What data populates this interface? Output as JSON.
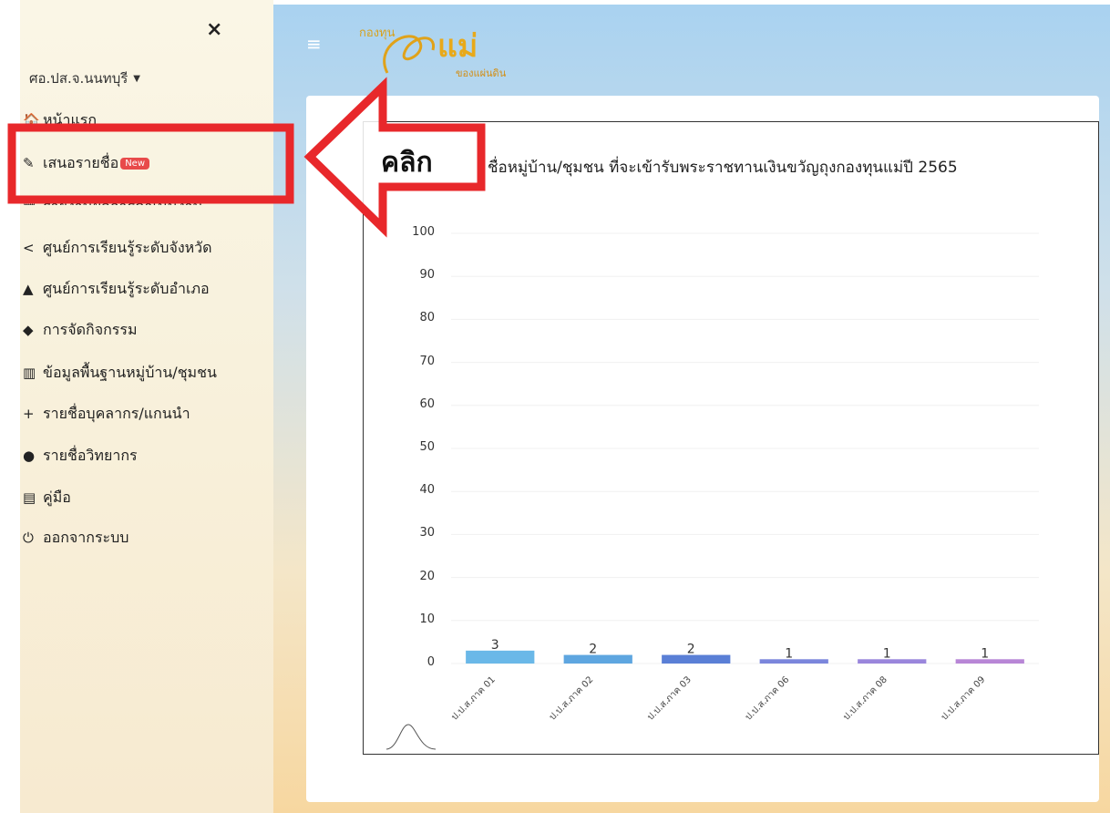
{
  "sidebar": {
    "close_label": "×",
    "org_dropdown": "ศอ.ปส.จ.นนทบุรี",
    "items": [
      {
        "icon": "home-icon",
        "glyph": "🏠",
        "label": "หน้าแรก"
      },
      {
        "icon": "edit-document-icon",
        "glyph": "✎",
        "label": "เสนอรายชื่อ",
        "badge": "New"
      },
      {
        "icon": "report-icon",
        "glyph": "▦",
        "label": "รายงานผลการดำเนินงาน"
      },
      {
        "icon": "share-icon",
        "glyph": "<",
        "label": "ศูนย์การเรียนรู้ระดับจังหวัด"
      },
      {
        "icon": "shapes-icon",
        "glyph": "▲",
        "label": "ศูนย์การเรียนรู้ระดับอำเภอ"
      },
      {
        "icon": "activity-icon",
        "glyph": "◆",
        "label": "การจัดกิจกรรม"
      },
      {
        "icon": "building-icon",
        "glyph": "▥",
        "label": "ข้อมูลพื้นฐานหมู่บ้าน/ชุมชน"
      },
      {
        "icon": "user-plus-icon",
        "glyph": "+",
        "label": "รายชื่อบุคลากร/แกนนำ"
      },
      {
        "icon": "microphone-icon",
        "glyph": "●",
        "label": "รายชื่อวิทยากร"
      },
      {
        "icon": "book-reader-icon",
        "glyph": "▤",
        "label": "คู่มือ"
      },
      {
        "icon": "power-icon",
        "glyph": "⏻",
        "label": "ออกจากระบบ"
      }
    ]
  },
  "header": {
    "menu_glyph": "≡",
    "logo_text_top": "กองทุน",
    "logo_text_main": "แม่",
    "logo_text_bottom": "ของแผ่นดิน"
  },
  "annotation": {
    "click_label": "คลิก",
    "colors": {
      "highlight": "#e8282b"
    }
  },
  "chart_data": {
    "type": "bar",
    "title": "ชื่อหมู่บ้าน/ชุมชน ที่จะเข้ารับพระราชทานเงินขวัญถุงกองทุนแม่ปี 2565",
    "categories": [
      "ป.ป.ส.ภาค 01",
      "ป.ป.ส.ภาค 02",
      "ป.ป.ส.ภาค 03",
      "ป.ป.ส.ภาค 06",
      "ป.ป.ส.ภาค 08",
      "ป.ป.ส.ภาค 09"
    ],
    "values": [
      3,
      2,
      2,
      1,
      1,
      1
    ],
    "data_labels": [
      "3",
      "2",
      "2",
      "1",
      "1",
      "1"
    ],
    "colors": [
      "#6ab8e8",
      "#5ea6e0",
      "#5a7fd6",
      "#7b86dc",
      "#9a86dc",
      "#b886d6"
    ],
    "ylim": [
      0,
      100
    ],
    "yticks": [
      "100",
      "90",
      "80",
      "70",
      "60",
      "50",
      "40",
      "30",
      "20",
      "10",
      "0"
    ],
    "grid": true
  }
}
